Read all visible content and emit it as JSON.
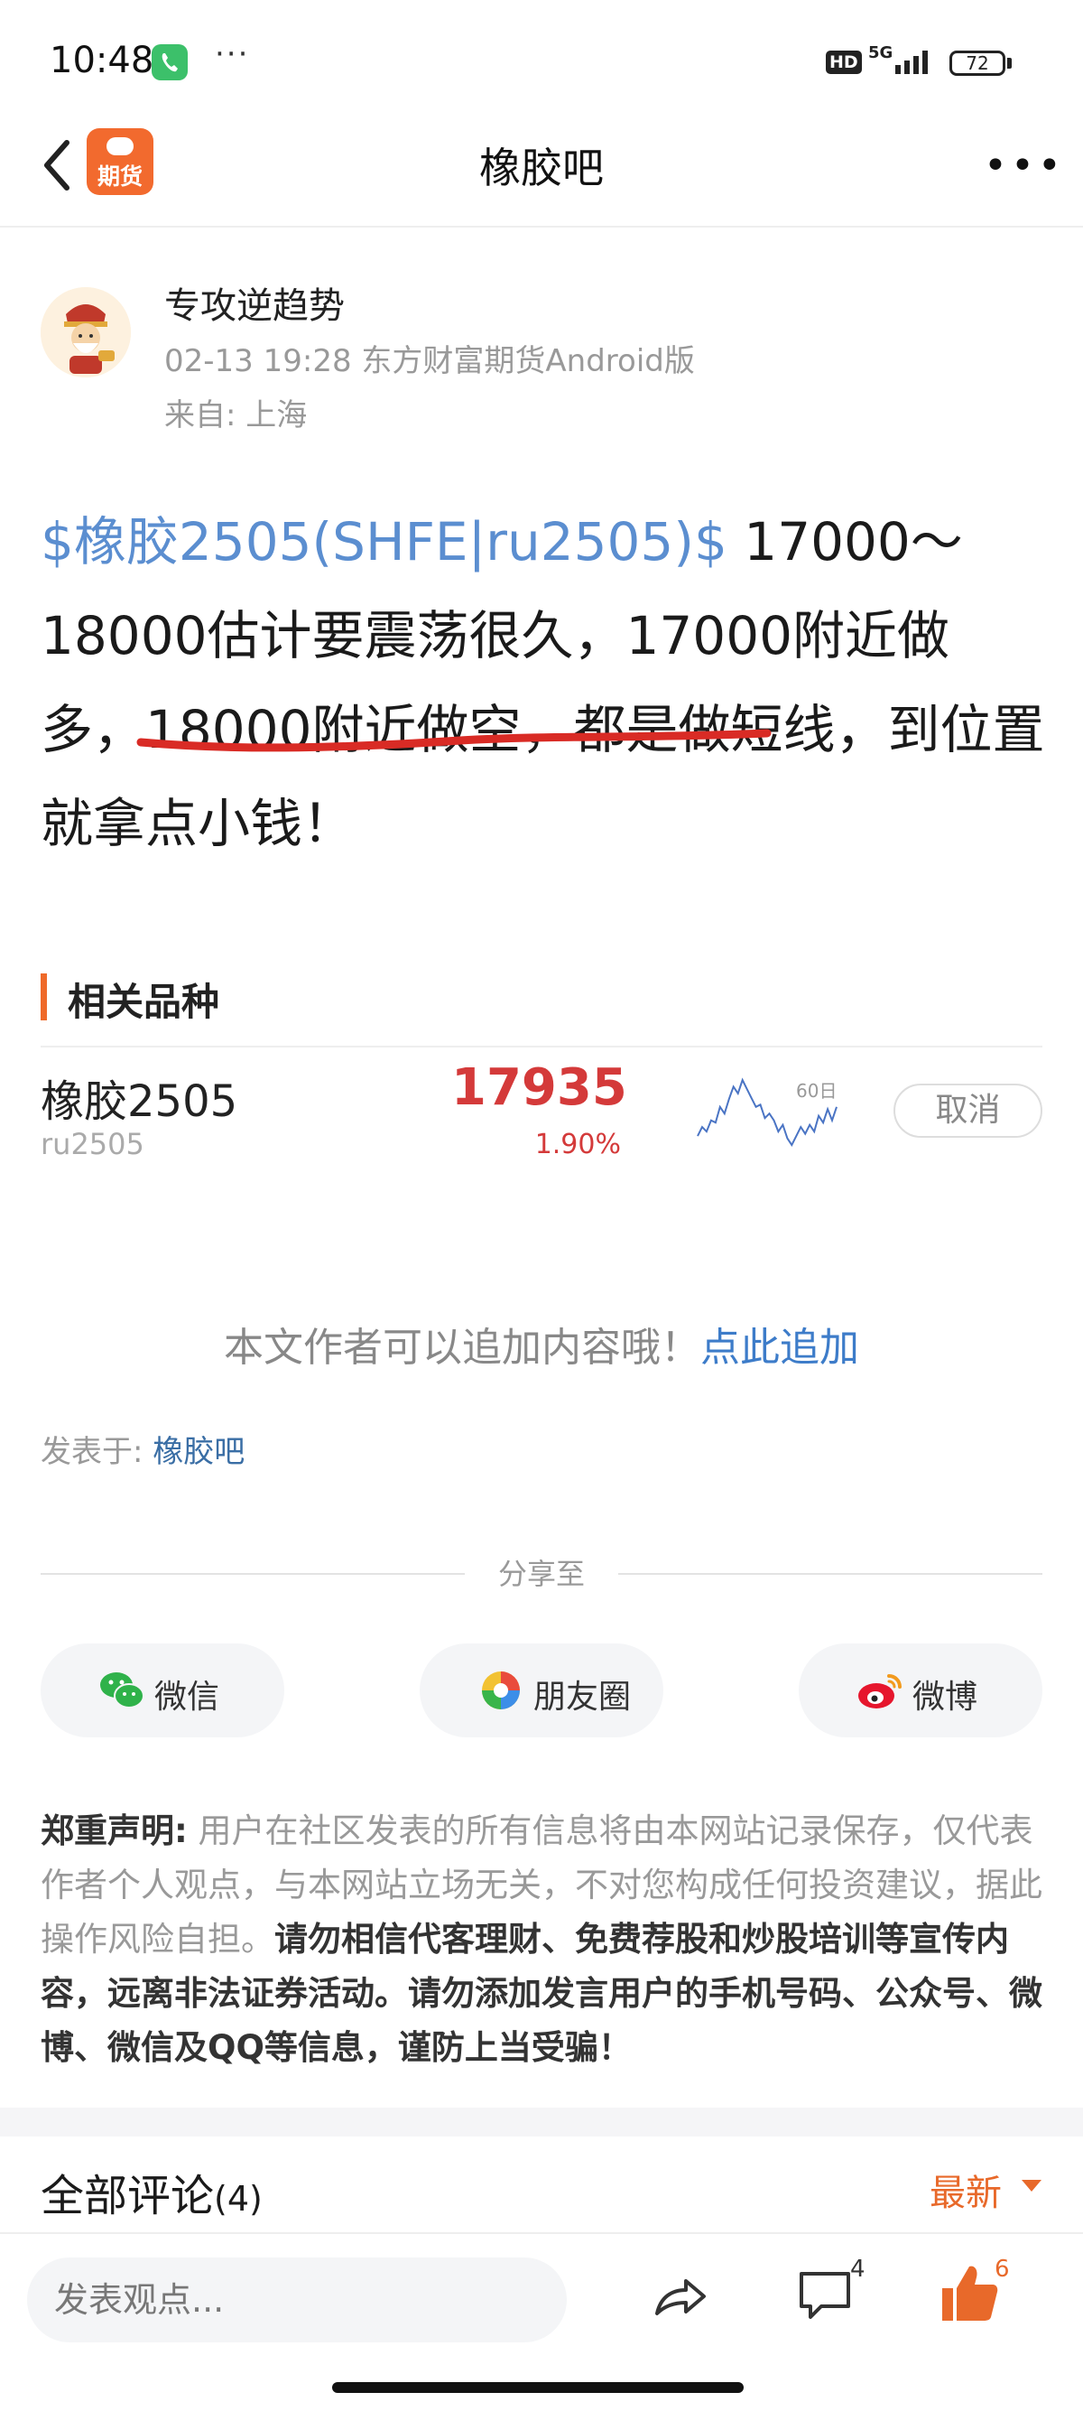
{
  "status_bar": {
    "time": "10:48",
    "dots": "···",
    "hd_badge": "HD",
    "network": "5G",
    "battery": "72"
  },
  "nav": {
    "logo_text": "期货",
    "title": "橡胶吧",
    "more": "•••"
  },
  "author": {
    "name": "专攻逆趋势",
    "meta": "02-13 19:28 东方财富期货Android版",
    "location": "来自: 上海"
  },
  "post": {
    "tag": "$橡胶2505(SHFE|ru2505)$",
    "text": " 17000～18000估计要震荡很久，17000附近做多，18000附近做空，都是做短线，到位置就拿点小钱！"
  },
  "related": {
    "title": "相关品种",
    "item": {
      "name": "橡胶2505",
      "code": "ru2505",
      "price": "17935",
      "change": "1.90%",
      "spark_label": "60日",
      "cancel_label": "取消"
    },
    "spark_points": [
      17620,
      17700,
      17660,
      17760,
      17740,
      17880,
      17820,
      17950,
      18060,
      18000,
      18120,
      18040,
      17960,
      17880,
      17900,
      17780,
      17820,
      17760,
      17660,
      17720,
      17600,
      17540,
      17620,
      17700,
      17640,
      17720,
      17660,
      17800,
      17740,
      17860,
      17760,
      17880
    ]
  },
  "append": {
    "text": "本文作者可以追加内容哦！",
    "link": "点此追加"
  },
  "posted": {
    "label": "发表于: ",
    "link": "橡胶吧"
  },
  "share": {
    "label": "分享至",
    "wechat": "微信",
    "moments": "朋友圈",
    "weibo": "微博"
  },
  "disclaimer": {
    "title": "郑重声明:",
    "body": " 用户在社区发表的所有信息将由本网站记录保存，仅代表作者个人观点，与本网站立场无关，不对您构成任何投资建议，据此操作风险自担。",
    "strong": "请勿相信代客理财、免费荐股和炒股培训等宣传内容，远离非法证券活动。请勿添加发言用户的手机号码、公众号、微博、微信及QQ等信息，谨防上当受骗！"
  },
  "comments": {
    "title": "全部评论",
    "count": "(4)",
    "sort": "最新"
  },
  "bottom_bar": {
    "placeholder": "发表观点...",
    "comment_count": "4",
    "like_count": "6"
  },
  "colors": {
    "accent": "#e8692a",
    "link": "#3d7cc9",
    "price_up": "#d43a3a"
  }
}
